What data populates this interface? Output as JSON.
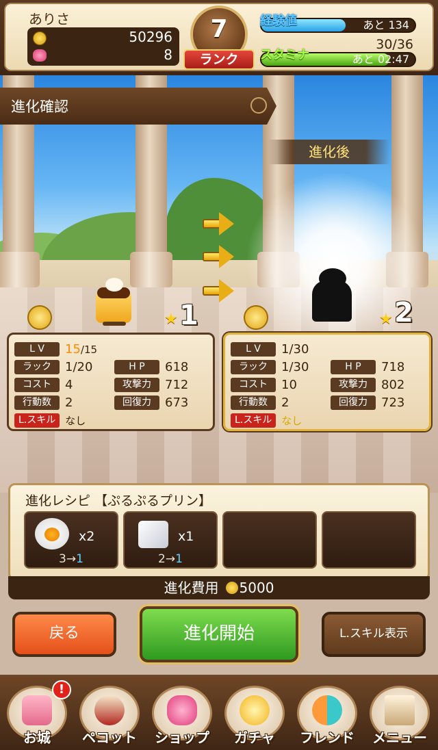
{
  "status": {
    "username": "ありさ",
    "coins": "50296",
    "gems": "8",
    "rank_number": "7",
    "rank_label": "ランク",
    "exp_label": "経験値",
    "exp_remaining": "あと 134",
    "exp_fill_fraction": 0.55,
    "stamina_label": "スタミナ",
    "stamina_value": "30/36",
    "stamina_remaining": "あと 02:47",
    "stamina_fill_fraction": 0.833
  },
  "header": {
    "title": "進化確認",
    "after_label": "進化後"
  },
  "before": {
    "star_count": "1",
    "lv_tag": "L V",
    "lv_current": "15",
    "lv_max": "/15",
    "luck_tag": "ラック",
    "luck": "1/20",
    "hp_tag": "H P",
    "hp": "618",
    "cost_tag": "コスト",
    "cost": "4",
    "atk_tag": "攻撃力",
    "atk": "712",
    "actions_tag": "行動数",
    "actions": "2",
    "rec_tag": "回復力",
    "rec": "673",
    "lskill_tag": "L.スキル",
    "lskill": "なし"
  },
  "after": {
    "star_count": "2",
    "lv_tag": "L V",
    "lv": "1/30",
    "luck_tag": "ラック",
    "luck": "1/30",
    "hp_tag": "H P",
    "hp": "718",
    "cost_tag": "コスト",
    "cost": "10",
    "atk_tag": "攻撃力",
    "atk": "802",
    "actions_tag": "行動数",
    "actions": "2",
    "rec_tag": "回復力",
    "rec": "723",
    "lskill_tag": "L.スキル",
    "lskill": "なし"
  },
  "recipe": {
    "title": "進化レシピ 【ぷるぷるプリン】",
    "slots": [
      {
        "icon": "egg-icon",
        "qty": "x2",
        "from": "3→",
        "to": "1"
      },
      {
        "icon": "sugar-icon",
        "qty": "x1",
        "from": "2→",
        "to": "1"
      },
      {
        "icon": "",
        "qty": "",
        "from": "",
        "to": ""
      },
      {
        "icon": "",
        "qty": "",
        "from": "",
        "to": ""
      }
    ],
    "cost_label": "進化費用",
    "cost_value": "5000"
  },
  "buttons": {
    "back": "戻る",
    "start": "進化開始",
    "lskill": "L.スキル表示"
  },
  "nav": {
    "castle": "お城",
    "pecot": "ペコット",
    "shop": "ショップ",
    "gacha": "ガチャ",
    "friend": "フレンド",
    "menu": "メニュー",
    "alert": "!"
  },
  "colors": {
    "accent_orange": "#ff8a00",
    "cyan_accent": "#5ed6ff",
    "start_green": "#2e9a20"
  }
}
